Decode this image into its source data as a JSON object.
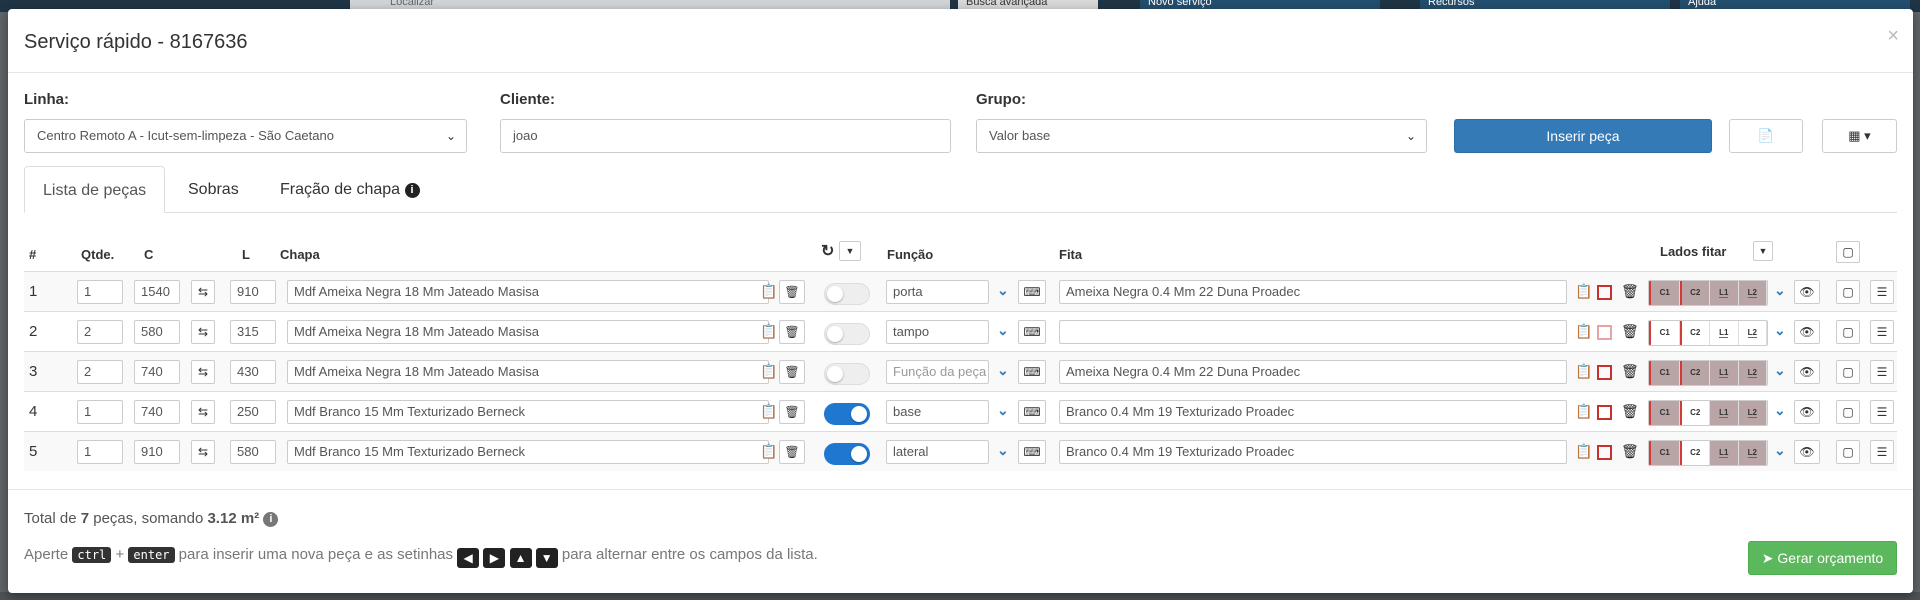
{
  "background": {
    "search_placeholder": "Localizar",
    "advanced_search": "Busca avançada",
    "new_service": "Novo serviço",
    "resources": "Recursos",
    "help": "Ajuda"
  },
  "modal": {
    "title": "Serviço rápido - 8167636",
    "close": "×"
  },
  "form": {
    "linha_label": "Linha:",
    "linha_value": "Centro Remoto A - Icut-sem-limpeza - São Caetano",
    "cliente_label": "Cliente:",
    "cliente_value": "joao",
    "grupo_label": "Grupo:",
    "grupo_value": "Valor base",
    "insert_button": "Inserir peça"
  },
  "tabs": [
    "Lista de peças",
    "Sobras",
    "Fração de chapa"
  ],
  "table": {
    "headers": {
      "num": "#",
      "qtde": "Qtde.",
      "c": "C",
      "l": "L",
      "chapa": "Chapa",
      "funcao": "Função",
      "fita": "Fita",
      "lados": "Lados fitar"
    },
    "funcao_placeholder": "Função da peça",
    "rows": [
      {
        "n": "1",
        "qtde": "1",
        "c": "1540",
        "l": "910",
        "chapa": "Mdf Ameixa Negra 18 Mm Jateado Masisa",
        "on": false,
        "funcao": "porta",
        "fita": "Ameixa Negra 0.4 Mm 22 Duna Proadec",
        "lados": [
          true,
          true,
          true,
          true
        ]
      },
      {
        "n": "2",
        "qtde": "2",
        "c": "580",
        "l": "315",
        "chapa": "Mdf Ameixa Negra 18 Mm Jateado Masisa",
        "on": false,
        "funcao": "tampo",
        "fita": "",
        "lados": [
          false,
          false,
          false,
          false
        ]
      },
      {
        "n": "3",
        "qtde": "2",
        "c": "740",
        "l": "430",
        "chapa": "Mdf Ameixa Negra 18 Mm Jateado Masisa",
        "on": false,
        "funcao": "",
        "fita": "Ameixa Negra 0.4 Mm 22 Duna Proadec",
        "lados": [
          true,
          true,
          true,
          true
        ]
      },
      {
        "n": "4",
        "qtde": "1",
        "c": "740",
        "l": "250",
        "chapa": "Mdf Branco 15 Mm Texturizado Berneck",
        "on": true,
        "funcao": "base",
        "fita": "Branco 0.4 Mm 19 Texturizado Proadec",
        "lados": [
          true,
          false,
          true,
          true
        ]
      },
      {
        "n": "5",
        "qtde": "1",
        "c": "910",
        "l": "580",
        "chapa": "Mdf Branco 15 Mm Texturizado Berneck",
        "on": true,
        "funcao": "lateral",
        "fita": "Branco 0.4 Mm 19 Texturizado Proadec",
        "lados": [
          true,
          false,
          true,
          true
        ]
      }
    ]
  },
  "lado_labels": [
    "C1",
    "C2",
    "L1",
    "L2"
  ],
  "footer": {
    "total_prefix": "Total de ",
    "total_count": "7",
    "total_mid": " peças, somando ",
    "total_area": "3.12 m²",
    "hint_1": "Aperte ",
    "key_ctrl": "ctrl",
    "hint_plus": " + ",
    "key_enter": "enter",
    "hint_2": " para inserir uma nova peça e as setinhas ",
    "hint_3": " para alternar entre os campos da lista.",
    "gerar_button": "Gerar orçamento"
  }
}
